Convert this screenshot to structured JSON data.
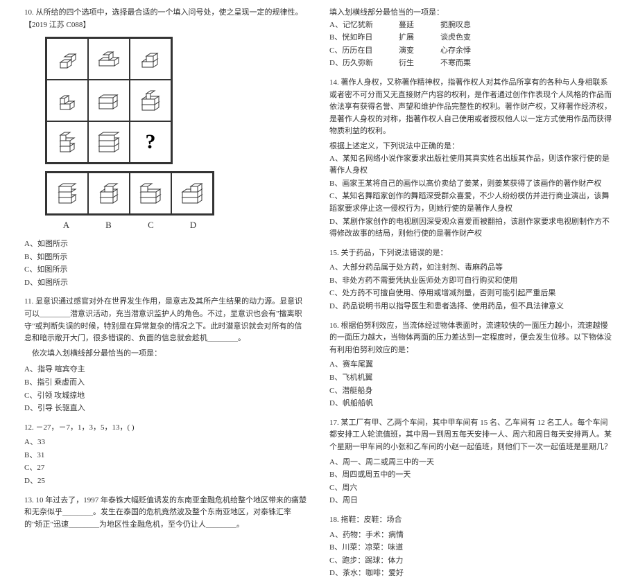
{
  "left": {
    "q10": {
      "title": "10. 从所给的四个选项中，选择最合适的一个填入问号处，使之呈现一定的规律性。【2019 江苏 C088】",
      "labels": [
        "A",
        "B",
        "C",
        "D"
      ],
      "opts": [
        "A、如图所示",
        "B、如图所示",
        "C、如图所示",
        "D、如图所示"
      ],
      "qmark": "?"
    },
    "q11": {
      "title": "11. 显意识通过感官对外在世界发生作用，是意志及其所产生结果的动力源。显意识可以________潜意识活动，充当潜意识监护人的角色。不过，显意识也会有\"擅离职守\"或判断失误的时候，特别是在异常复杂的情况之下。此时潜意识就会对所有的信息和暗示敞开大门，很多错误的、负面的信息就会趁机________。",
      "sub": "依次填入划横线部分最恰当的一项是：",
      "opts": [
        "A、指导    喧宾夺主",
        "B、指引    乘虚而入",
        "C、引领    攻城掠地",
        "D、引导    长驱直入"
      ]
    },
    "q12": {
      "title": "12. －27，－7，1，3，5，13，( )",
      "opts": [
        "A、33",
        "B、31",
        "C、27",
        "D、25"
      ]
    },
    "q13": {
      "title": "13. 10 年过去了，1997 年泰铢大幅贬值诱发的东南亚金融危机给整个地区带来的痛楚和无奈似乎________。发生在泰国的危机竟然波及整个东南亚地区，对泰铢汇率的\"矫正\"迅速________为地区性金融危机，至今仍让人________。"
    }
  },
  "right": {
    "q13b": {
      "sub": "填入划横线部分最恰当的一项是：",
      "rows": [
        [
          "A、记忆犹新",
          "蔓延",
          "扼腕叹息"
        ],
        [
          "B、恍如昨日",
          "扩展",
          "谈虎色变"
        ],
        [
          "C、历历在目",
          "演变",
          "心存余悸"
        ],
        [
          "D、历久弥新",
          "衍生",
          "不寒而栗"
        ]
      ]
    },
    "q14": {
      "title": "14. 著作人身权，又称著作精神权，指著作权人对其作品所享有的各种与人身相联系或者密不可分而又无直接财产内容的权利，是作者通过创作作表现个人风格的作品而依法享有获得名誉、声望和维护作品完整性的权利。著作财产权，又称著作经济权，是著作人身权的对称，指著作权人自己使用或者授权他人以一定方式使用作品而获得物质利益的权利。",
      "sub": "根据上述定义，下列说法中正确的是：",
      "opts": [
        "A、某知名网络小说作家要求出版社使用其真实姓名出版其作品，则该作家行使的是著作人身权",
        "B、画家王某将自己的画作以高价卖给了姜某，则姜某获得了该画作的著作财产权",
        "C、某知名舞蹈家创作的舞蹈深受群众喜爱，不少人纷纷模仿并进行商业演出，该舞蹈家要求停止这一侵权行为，则她行使的是著作人身权",
        "D、某剧作家创作的电视剧因深受观众喜爱而被翻拍，该剧作家要求电视剧制作方不得修改故事的结局，则他行使的是著作财产权"
      ]
    },
    "q15": {
      "title": "15. 关于药品，下列说法错误的是：",
      "opts": [
        "A、大部分药品属于处方药，如注射剂、毒麻药品等",
        "B、非处方药不需要凭执业医师处方即可自行购买和使用",
        "C、处方药不可擅自使用、停用或增减剂量，否则可能引起严重后果",
        "D、药品说明书用以指导医生和患者选择、使用药品，但不具法律意义"
      ]
    },
    "q16": {
      "title": "16. 根据伯努利效应，当流体经过物体表面时，流速较快的一面压力越小，流速越慢的一面压力越大，当物体两面的压力差达到一定程度时，便会发生位移。以下物体没有利用伯努利效应的是：",
      "opts": [
        "A、赛车尾翼",
        "B、飞机机翼",
        "C、潜艇船身",
        "D、帆船船帆"
      ]
    },
    "q17": {
      "title": "17. 某工厂有甲、乙两个车间，其中甲车间有 15 名、乙车间有 12 名工人。每个车间都安排工人轮流值班，其中周一到周五每天安排一人、周六和周日每天安排两人。某个星期一甲车间的小张和乙车间的小赵一起值班，则他们下一次一起值班是星期几？",
      "opts": [
        "A、周一、周二或周三中的一天",
        "B、周四或周五中的一天",
        "C、周六",
        "D、周日"
      ]
    },
    "q18": {
      "title": "18. 拖鞋：皮鞋：场合",
      "opts": [
        "A、药物：手术：病情",
        "B、川菜：凉菜：味道",
        "C、跑步：踢球：体力",
        "D、茶水：咖啡：爱好"
      ]
    }
  }
}
